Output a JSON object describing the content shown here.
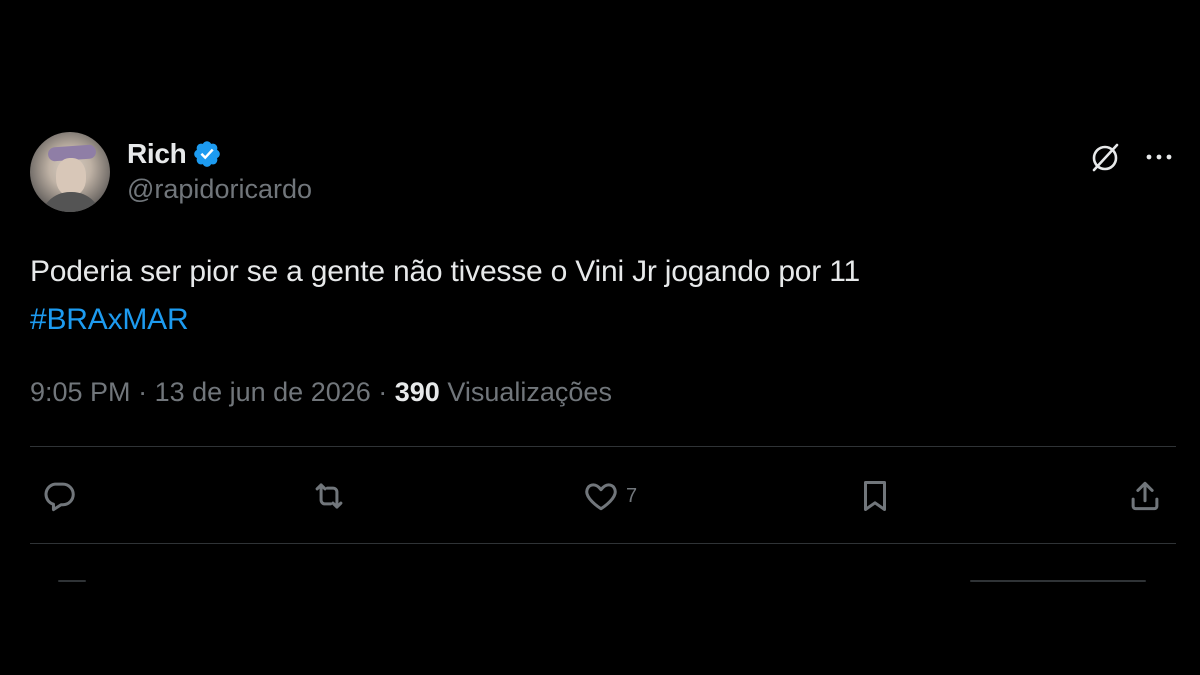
{
  "author": {
    "display_name": "Rich",
    "handle": "@rapidoricardo",
    "verified": true,
    "avatar_icon": "profile-photo"
  },
  "tweet": {
    "text": "Poderia ser pior se a gente não tivesse o Vini Jr jogando por 11",
    "hashtag": "#BRAxMAR"
  },
  "meta": {
    "time": "9:05 PM",
    "separator": " · ",
    "date": "13 de jun de 2026",
    "views_count": "390",
    "views_label": "Visualizações"
  },
  "actions": {
    "reply": {
      "icon": "reply-icon",
      "count": ""
    },
    "retweet": {
      "icon": "retweet-icon",
      "count": ""
    },
    "like": {
      "icon": "heart-icon",
      "count": "7"
    },
    "bookmark": {
      "icon": "bookmark-icon",
      "count": ""
    },
    "share": {
      "icon": "share-icon",
      "count": ""
    }
  },
  "colors": {
    "background": "#000000",
    "text": "#e7e9ea",
    "secondary": "#71767b",
    "accent": "#1d9bf0",
    "divider": "#2f3336"
  }
}
